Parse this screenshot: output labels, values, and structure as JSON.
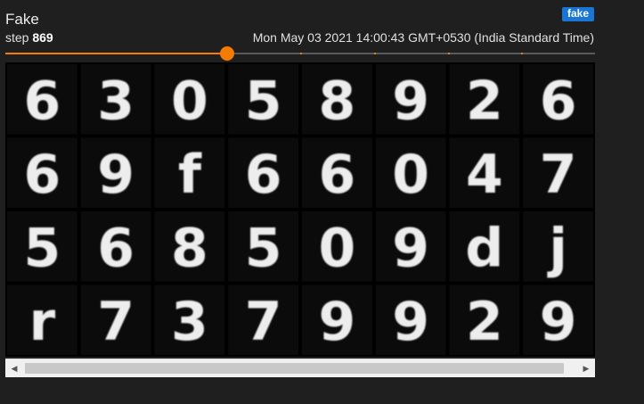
{
  "card": {
    "title": "Fake",
    "tag": "fake",
    "step_label": "step",
    "step_value": "869",
    "timestamp": "Mon May 03 2021 14:00:43 GMT+0530 (India Standard Time)"
  },
  "slider": {
    "progress": 0.376,
    "marks": [
      0.5,
      0.625,
      0.75,
      0.875
    ]
  },
  "image_grid": {
    "rows": 4,
    "cols": 8,
    "digits": [
      "6",
      "3",
      "0",
      "5",
      "8",
      "9",
      "2",
      "6",
      "6",
      "9",
      "f",
      "6",
      "6",
      "0",
      "4",
      "7",
      "5",
      "6",
      "8",
      "5",
      "0",
      "9",
      "d",
      "j",
      "r",
      "7",
      "3",
      "7",
      "9",
      "9",
      "2",
      "9"
    ]
  },
  "scrollbar": {
    "left_icon": "triangle-left-icon",
    "right_icon": "triangle-right-icon",
    "thumb_fraction": 0.914
  },
  "colors": {
    "accent": "#f57c00",
    "tag": "#1976d2",
    "background": "#1f1f20"
  }
}
